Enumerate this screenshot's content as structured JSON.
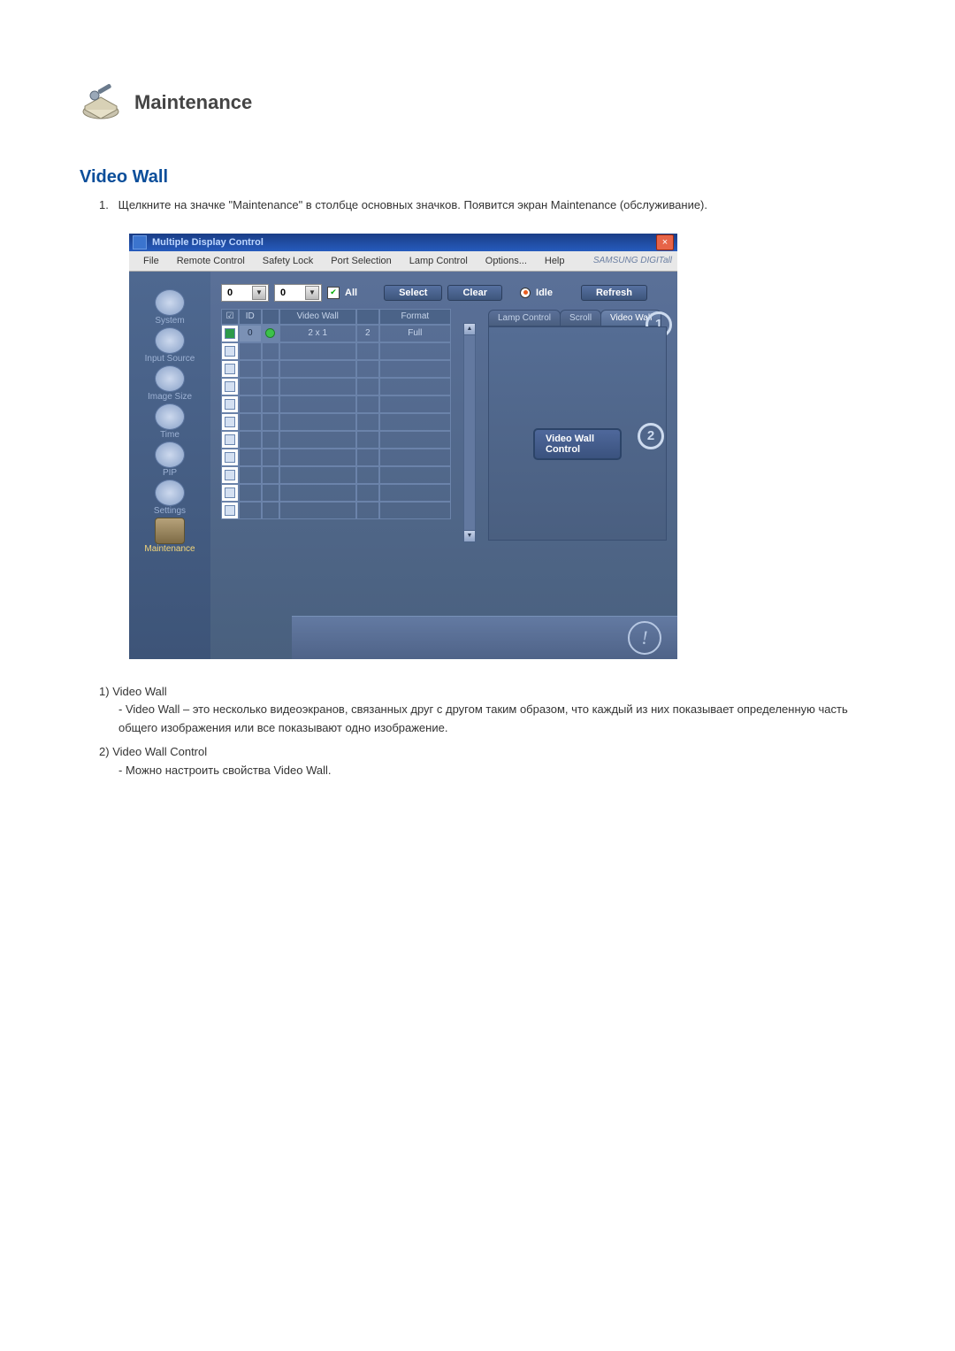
{
  "heading": "Maintenance",
  "section_title": "Video Wall",
  "intro_num": "1.",
  "intro_text": "Щелкните на значке \"Maintenance\" в столбце основных значков. Появится экран Maintenance (обслуживание).",
  "window": {
    "title": "Multiple Display Control",
    "close_glyph": "×",
    "menu": [
      "File",
      "Remote Control",
      "Safety Lock",
      "Port Selection",
      "Lamp Control",
      "Options...",
      "Help"
    ],
    "brand": "SAMSUNG DIGITall"
  },
  "sidebar": [
    {
      "label": "System"
    },
    {
      "label": "Input Source"
    },
    {
      "label": "Image Size"
    },
    {
      "label": "Time"
    },
    {
      "label": "PIP"
    },
    {
      "label": "Settings"
    },
    {
      "label": "Maintenance",
      "active": true
    }
  ],
  "toolbar": {
    "select1": "0",
    "select2": "0",
    "all_label": "All",
    "btn_select": "Select",
    "btn_clear": "Clear",
    "idle_label": "Idle",
    "btn_refresh": "Refresh"
  },
  "grid": {
    "headers": {
      "check": "☑",
      "id": "ID",
      "stat": "",
      "vw": "Video Wall",
      "num": "",
      "fmt": "Format"
    },
    "row_id": "0",
    "row_vw": "2 x 1",
    "row_num": "2",
    "row_fmt": "Full"
  },
  "tabs": {
    "lamp": "Lamp Control",
    "scroll": "Scroll",
    "video": "Video Wall"
  },
  "vwc_button": "Video Wall Control",
  "callouts": {
    "one": "1",
    "two": "2"
  },
  "notes": {
    "n1_num": "1)",
    "n1_title": "Video Wall",
    "n1_body": "- Video Wall – это несколько видеоэкранов, связанных друг с другом таким образом, что каждый из них показывает определенную часть общего изображения или все показывают одно изображение.",
    "n2_num": "2)",
    "n2_title": "Video Wall Control",
    "n2_body": "- Можно настроить свойства Video Wall."
  }
}
